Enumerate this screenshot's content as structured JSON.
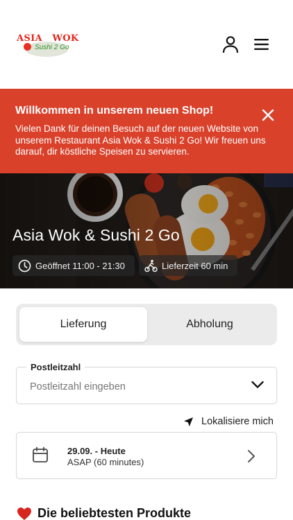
{
  "header": {
    "logo": {
      "word1": "ASIA",
      "word2": "WOK",
      "tagline": "Sushi 2 Go"
    },
    "icons": {
      "user": "user-icon",
      "menu": "hamburger-menu-icon"
    }
  },
  "banner": {
    "title": "Willkommen in unserem neuen Shop!",
    "text": "Vielen Dank für deinen Besuch auf der neuen Website von unserem Restaurant Asia Wok & Sushi 2 Go! Wir freuen uns darauf, dir köstliche Speisen zu servieren.",
    "color": "#d9412b",
    "close_icon": "close-icon"
  },
  "hero": {
    "title": "Asia Wok & Sushi 2 Go",
    "opening": "Geöffnet 11:00 - 21:30",
    "delivery_time": "Lieferzeit 60 min"
  },
  "order_type": {
    "options": [
      "Lieferung",
      "Abholung"
    ],
    "selected": "Lieferung"
  },
  "postal": {
    "label": "Postleitzahl",
    "placeholder": "Postleitzahl eingeben",
    "value": ""
  },
  "locate": {
    "label": "Lokalisiere mich"
  },
  "date": {
    "main": "29.09. - Heute",
    "sub": "ASAP (60 minutes)"
  },
  "section": {
    "title": "Die beliebtesten Produkte"
  }
}
